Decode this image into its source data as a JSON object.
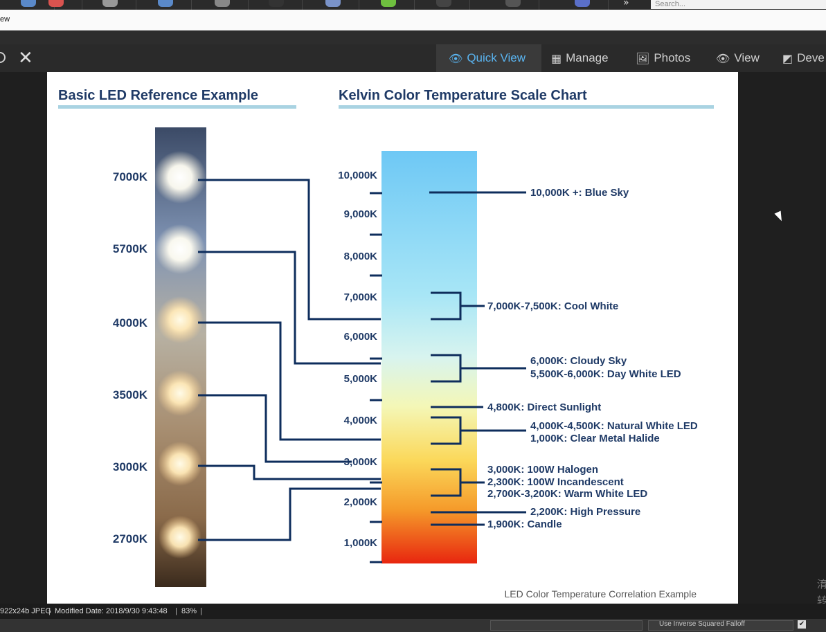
{
  "taskbar": {
    "search_placeholder": "Search...",
    "more_glyph": "»",
    "icons": [
      "app-icon",
      "app-icon",
      "app-icon",
      "app-icon",
      "app-icon",
      "app-icon",
      "app-icon",
      "app-icon",
      "app-icon",
      "app-icon",
      "app-icon"
    ]
  },
  "window": {
    "title_fragment": "ew"
  },
  "viewer_toolbar": {
    "tabs": [
      {
        "label": "Quick View",
        "icon": "eye-icon",
        "active": true
      },
      {
        "label": "Manage",
        "icon": "grid-icon",
        "active": false
      },
      {
        "label": "Photos",
        "icon": "photos-icon",
        "active": false
      },
      {
        "label": "View",
        "icon": "eye-icon",
        "active": false
      },
      {
        "label": "Deve",
        "icon": "develop-icon",
        "active": false
      }
    ],
    "close_glyph": "✕"
  },
  "image": {
    "left_title": "Basic LED Reference Example",
    "right_title": "Kelvin Color Temperature Scale Chart",
    "footer": "LED Color Temperature Correlation Example",
    "led_labels": [
      "7000K",
      "5700K",
      "4000K",
      "3500K",
      "3000K",
      "2700K"
    ],
    "scale_ticks": [
      "10,000K",
      "9,000K",
      "8,000K",
      "7,000K",
      "6,000K",
      "5,000K",
      "4,000K",
      "3,000K",
      "2,000K",
      "1,000K"
    ],
    "annotations": [
      "10,000K +: Blue Sky",
      "7,000K-7,500K: Cool White",
      "6,000K: Cloudy Sky",
      "5,500K-6,000K: Day White LED",
      "4,800K: Direct Sunlight",
      "4,000K-4,500K: Natural White LED",
      "1,000K: Clear Metal Halide",
      "3,000K: 100W Halogen",
      "2,300K: 100W Incandescent",
      "2,700K-3,200K: Warm White LED",
      "2,200K: High Pressure",
      "1,900K: Candle"
    ],
    "colors": {
      "title_blue": "#1f3a66",
      "underline": "#a9d3e2",
      "line_navy": "#0e2d5c"
    }
  },
  "right_margin_cjk": [
    "淯",
    "转"
  ],
  "status_bar": {
    "dimensions": "922x24b JPEG",
    "modified": "Modified Date: 2018/9/30 9:43:48",
    "zoom": "83%",
    "sep": "|"
  },
  "bottom_panel": {
    "option_label": "Use Inverse Squared Falloff",
    "checkbox_glyph": "✔"
  }
}
